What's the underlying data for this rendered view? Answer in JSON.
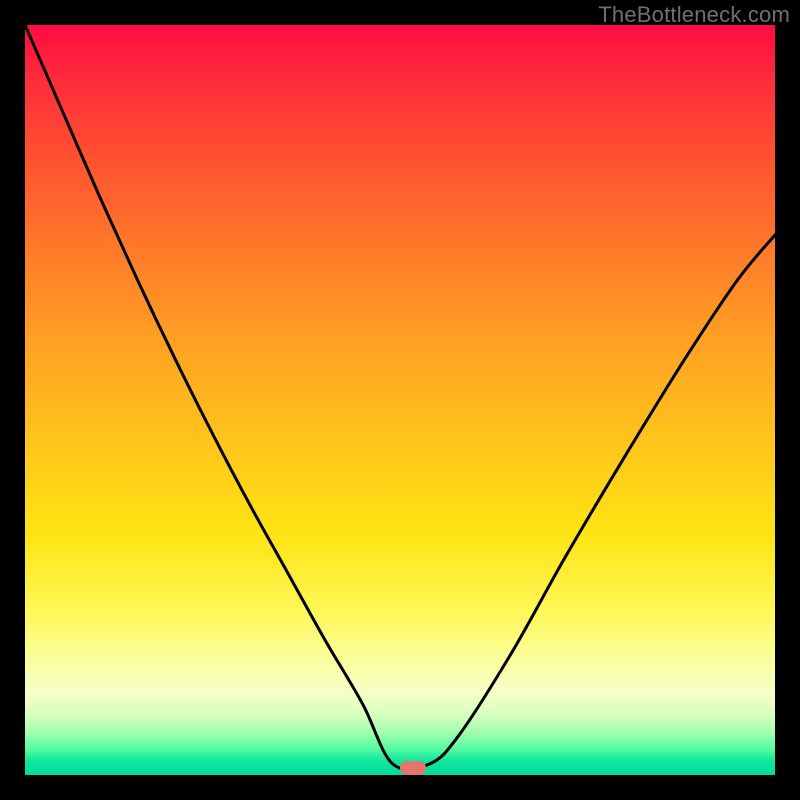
{
  "attribution": "TheBottleneck.com",
  "marker": {
    "x_frac": 0.517,
    "y_frac": 0.991,
    "color": "#e4756b"
  },
  "chart_data": {
    "type": "line",
    "title": "",
    "xlabel": "",
    "ylabel": "",
    "xlim": [
      0,
      1
    ],
    "ylim": [
      0,
      1
    ],
    "series": [
      {
        "name": "bottleneck-curve",
        "x": [
          0.0,
          0.05,
          0.1,
          0.15,
          0.2,
          0.25,
          0.3,
          0.35,
          0.4,
          0.45,
          0.49,
          0.54,
          0.58,
          0.65,
          0.72,
          0.8,
          0.88,
          0.95,
          1.0
        ],
        "y": [
          1.0,
          0.885,
          0.77,
          0.66,
          0.555,
          0.455,
          0.36,
          0.27,
          0.18,
          0.095,
          0.015,
          0.015,
          0.055,
          0.165,
          0.29,
          0.425,
          0.555,
          0.66,
          0.72
        ],
        "note": "y measured as fraction from bottom (0) to top (1); values estimated from pixel positions"
      }
    ]
  }
}
